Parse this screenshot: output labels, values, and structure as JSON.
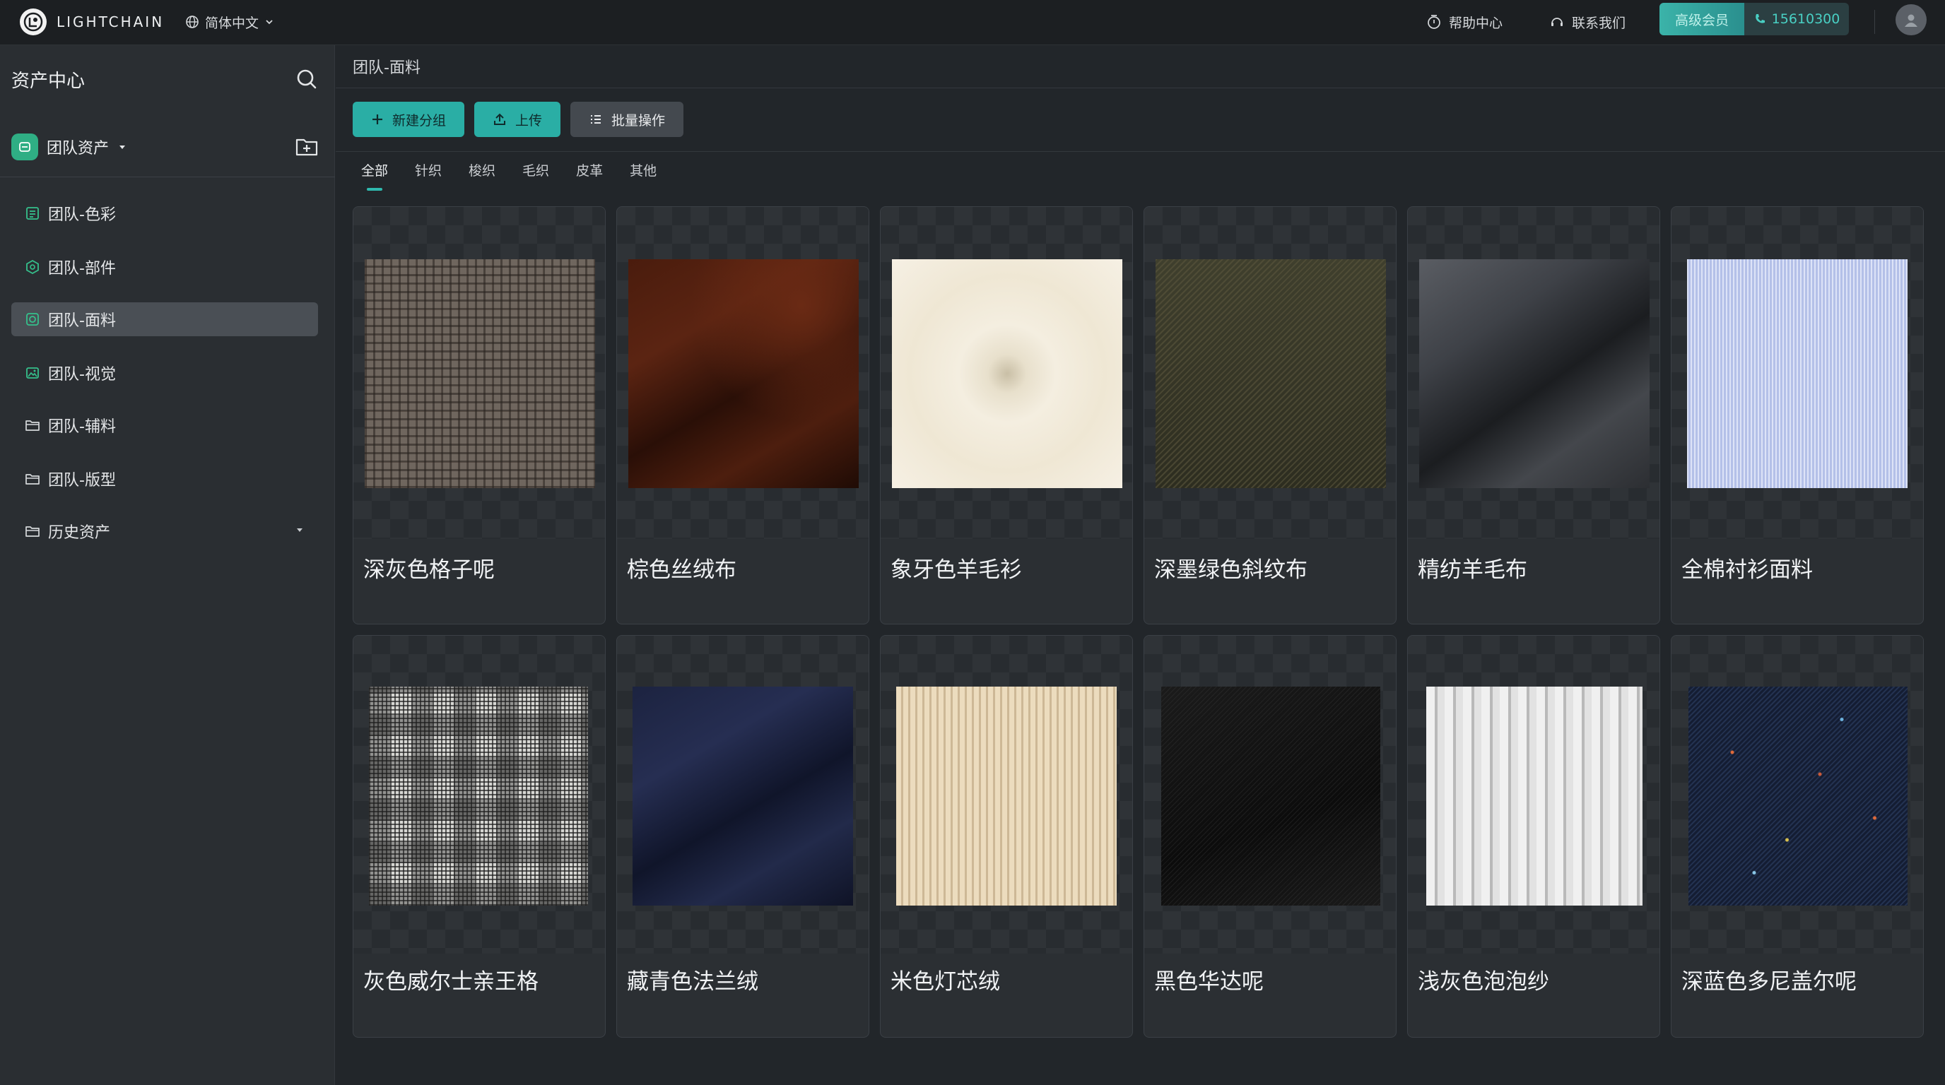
{
  "topbar": {
    "brand": "LIGHTCHAIN",
    "language": "简体中文",
    "help": "帮助中心",
    "contact": "联系我们",
    "upgrade": "高级会员",
    "phone": "15610300"
  },
  "sidebar": {
    "title": "资产中心",
    "team": "团队资产",
    "items": [
      {
        "label": "团队-色彩",
        "icon": "palette-icon"
      },
      {
        "label": "团队-部件",
        "icon": "component-icon"
      },
      {
        "label": "团队-面料",
        "icon": "fabric-icon",
        "active": true
      },
      {
        "label": "团队-视觉",
        "icon": "image-icon"
      },
      {
        "label": "团队-辅料",
        "icon": "folder-icon"
      },
      {
        "label": "团队-版型",
        "icon": "folder-icon"
      },
      {
        "label": "历史资产",
        "icon": "folder-icon"
      }
    ]
  },
  "content": {
    "breadcrumb": "团队-面料",
    "toolbar": {
      "new_folder": "新建分组",
      "upload": "上传",
      "batch": "批量操作"
    },
    "tabs": [
      "全部",
      "针织",
      "梭织",
      "毛织",
      "皮革",
      "其他"
    ],
    "active_tab": 0,
    "fabrics": [
      {
        "name": "深灰色格子呢"
      },
      {
        "name": "棕色丝绒布"
      },
      {
        "name": "象牙色羊毛衫"
      },
      {
        "name": "深墨绿色斜纹布"
      },
      {
        "name": "精纺羊毛布"
      },
      {
        "name": "全棉衬衫面料"
      },
      {
        "name": "灰色威尔士亲王格"
      },
      {
        "name": "藏青色法兰绒"
      },
      {
        "name": "米色灯芯绒"
      },
      {
        "name": "黑色华达呢"
      },
      {
        "name": "浅灰色泡泡纱"
      },
      {
        "name": "深蓝色多尼盖尔呢"
      }
    ]
  },
  "colors": {
    "accent": "#2aaea5",
    "sidebar_bg": "#2a2e32",
    "content_bg": "#22262a",
    "topbar_bg": "#1c1f22",
    "team_badge": "#2fae84"
  }
}
